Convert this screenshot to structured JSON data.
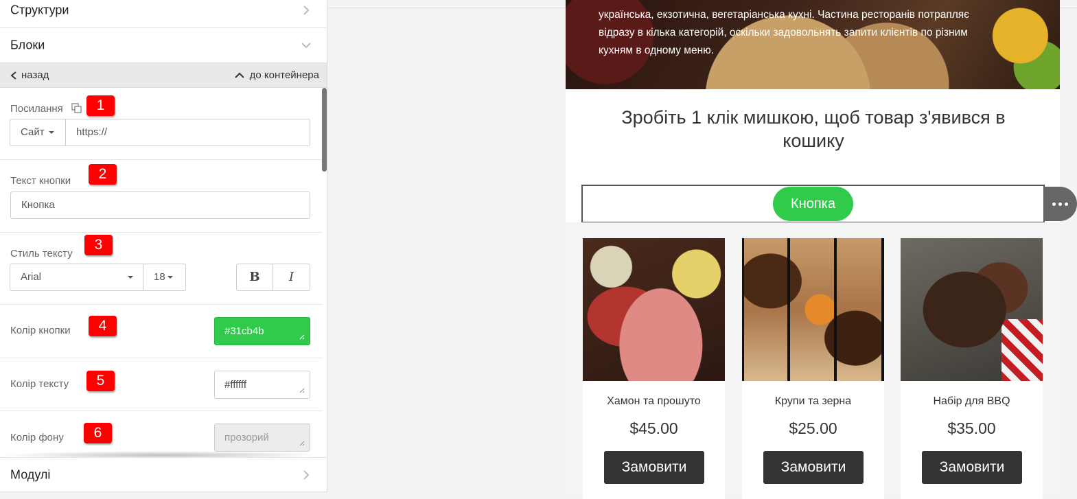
{
  "sidebar": {
    "sections": {
      "structures": "Структури",
      "blocks": "Блоки",
      "modules": "Модулі"
    },
    "nav": {
      "back": "назад",
      "to_container": "до контейнера"
    },
    "fields": {
      "link": {
        "label": "Посилання",
        "badge": "1",
        "type_select": "Сайт",
        "value": "https://"
      },
      "button_text": {
        "label": "Текст кнопки",
        "badge": "2",
        "value": "Кнопка"
      },
      "text_style": {
        "label": "Стиль тексту",
        "badge": "3",
        "font": "Arial",
        "size": "18",
        "bold": "B",
        "italic": "I"
      },
      "button_color": {
        "label": "Колір кнопки",
        "badge": "4",
        "value": "#31cb4b"
      },
      "text_color": {
        "label": "Колір тексту",
        "badge": "5",
        "value": "#ffffff"
      },
      "bg_color": {
        "label": "Колір фону",
        "badge": "6",
        "value": "прозорий"
      }
    }
  },
  "preview": {
    "hero_text": "українська, екзотична, вегетаріанська кухні. Частина ресторанів потрапляє відразу в кілька категорій, оскільки задовольнять запити клієнтів по різним кухням в одному меню.",
    "headline": "Зробіть 1 клік мишкою, щоб товар з'явився в кошику",
    "button_label": "Кнопка",
    "products": [
      {
        "name": "Хамон та прошуто",
        "price": "$45.00",
        "order": "Замовити"
      },
      {
        "name": "Крупи та зерна",
        "price": "$25.00",
        "order": "Замовити"
      },
      {
        "name": "Набір для BBQ",
        "price": "$35.00",
        "order": "Замовити"
      }
    ]
  },
  "colors": {
    "button_green": "#31cb4b",
    "badge_red": "#ff0000",
    "dark_button": "#333333"
  }
}
